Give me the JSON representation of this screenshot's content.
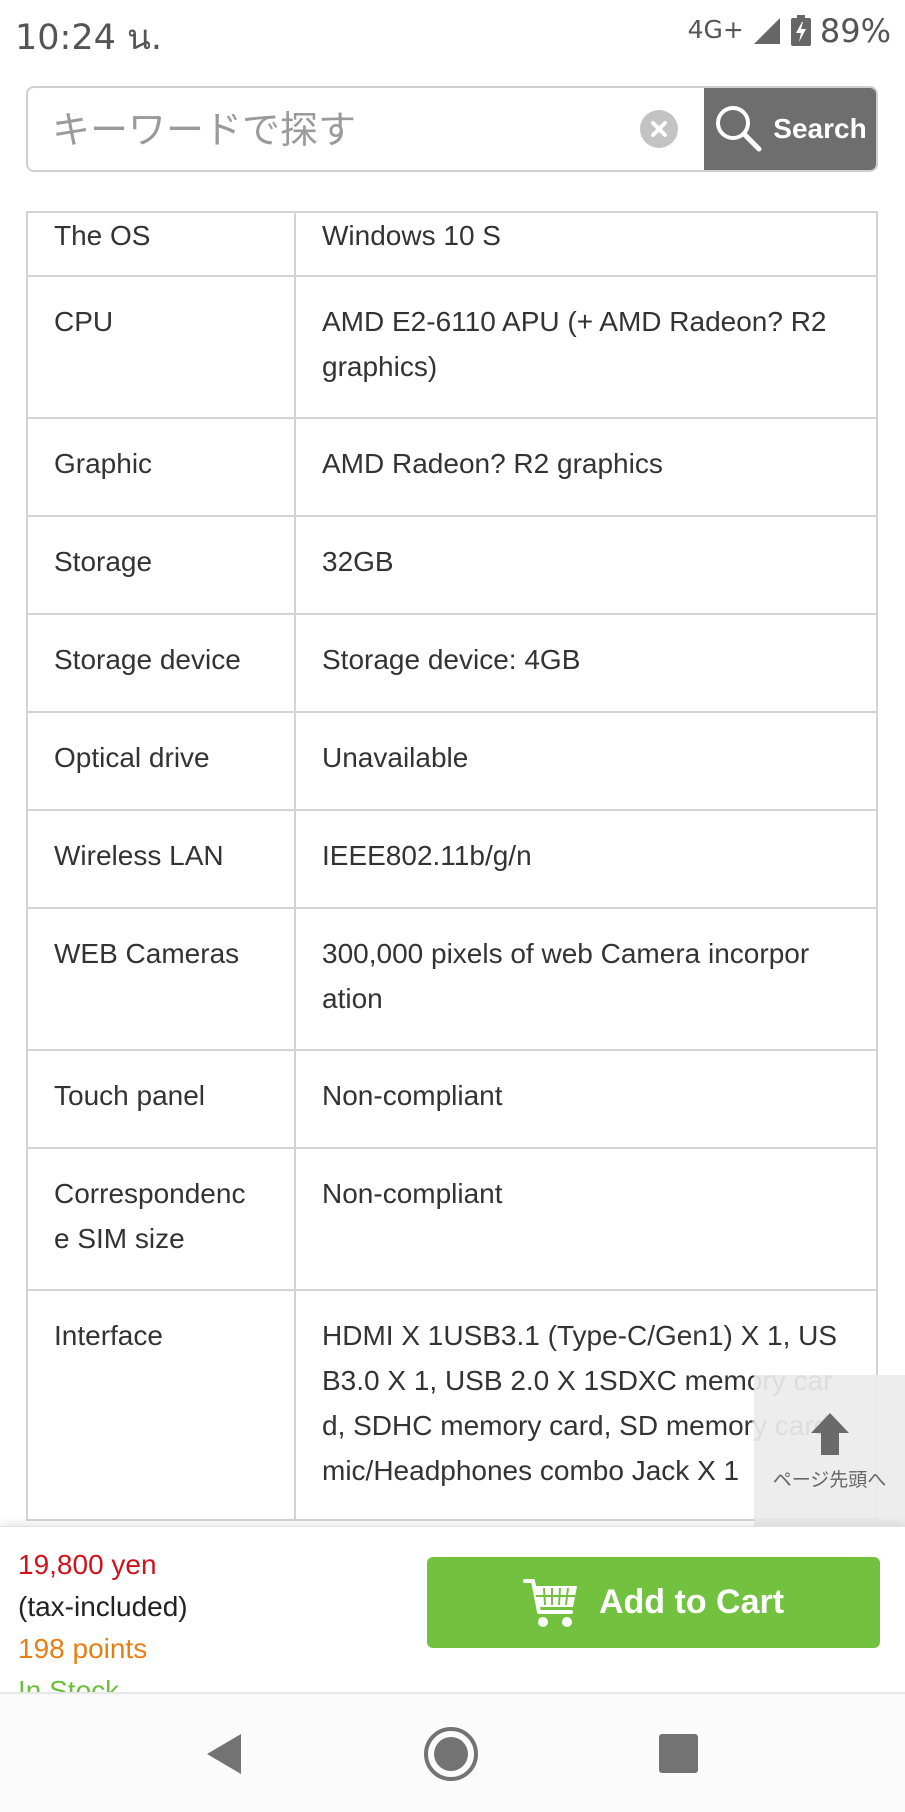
{
  "status_bar": {
    "time": "10:24 น.",
    "network": "4G+",
    "battery": "89%"
  },
  "search": {
    "placeholder": "キーワードで探す",
    "button_label": "Search"
  },
  "specs": [
    {
      "label": "The OS",
      "value": "Windows 10 S"
    },
    {
      "label": "CPU",
      "value": "AMD E2-6110 APU (+ AMD Radeon? R2 graphics)"
    },
    {
      "label": "Graphic",
      "value": "AMD Radeon? R2 graphics"
    },
    {
      "label": "Storage",
      "value": "32GB"
    },
    {
      "label": "Storage device",
      "value": "Storage device: 4GB"
    },
    {
      "label": "Optical drive",
      "value": "Unavailable"
    },
    {
      "label": "Wireless LAN",
      "value": "IEEE802.11b/g/n"
    },
    {
      "label": "WEB Cameras",
      "value": "300,000 pixels of web Camera incorpor ation"
    },
    {
      "label": "Touch panel",
      "value": "Non-compliant"
    },
    {
      "label": "Correspondenc e SIM size",
      "value": "Non-compliant"
    },
    {
      "label": "Interface",
      "value": "HDMI X 1USB3.1 (Type-C/Gen1) X 1, US B3.0 X 1, USB 2.0 X 1SDXC memory car d, SDHC memory card, SD memory card mic/Headphones combo Jack X 1"
    }
  ],
  "page_top": {
    "label": "ページ先頭へ"
  },
  "purchase": {
    "price": "19,800 yen",
    "tax_note": "(tax-included)",
    "points": "198 points",
    "stock": "In Stock",
    "cart_label": "Add to Cart"
  },
  "colors": {
    "price": "#d0121b",
    "points": "#e87e12",
    "cart_button": "#72c240",
    "search_button": "#6e6e6e"
  },
  "icons": {
    "search": "magnifier-icon",
    "clear": "clear-x-icon",
    "page_top": "arrow-up-icon",
    "cart": "cart-icon",
    "nav_back": "triangle-back-icon",
    "nav_home": "circle-home-icon",
    "nav_recent": "square-recent-icon"
  }
}
